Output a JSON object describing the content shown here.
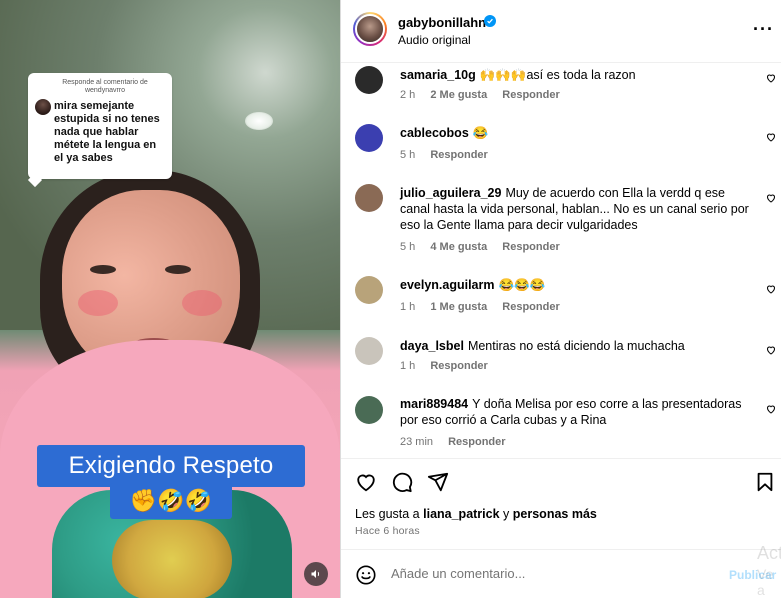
{
  "video": {
    "comment_card": {
      "reply_label": "Responde al comentario de wendynavrro",
      "text": "mira semejante estupida si no tenes nada que hablar métete la lengua en el ya sabes"
    },
    "caption": "Exigiendo Respeto",
    "caption_emojis": "✊🤣🤣",
    "mute_icon": "speaker-icon"
  },
  "post": {
    "username": "gabybonillahn",
    "subtitle": "Audio original",
    "verified": true
  },
  "comments": [
    {
      "user": "samaria_10g",
      "text": "🙌🙌🙌así es toda la razon",
      "time": "2 h",
      "likes": "2 Me gusta",
      "reply": "Responder",
      "avatar_color": "#2a2a2a"
    },
    {
      "user": "cablecobos",
      "text": "😂",
      "time": "5 h",
      "likes": "",
      "reply": "Responder",
      "avatar_color": "#3b3fb0"
    },
    {
      "user": "julio_aguilera_29",
      "text": "Muy de acuerdo con Ella la verdd q ese canal hasta la vida personal, hablan... No es un canal serio por eso la Gente llama para decir vulgaridades",
      "time": "5 h",
      "likes": "4 Me gusta",
      "reply": "Responder",
      "avatar_color": "#8a6a55"
    },
    {
      "user": "evelyn.aguilarm",
      "text": "😂😂😂",
      "time": "1 h",
      "likes": "1 Me gusta",
      "reply": "Responder",
      "avatar_color": "#b8a37a"
    },
    {
      "user": "daya_lsbel",
      "text": "Mentiras no está diciendo la muchacha",
      "time": "1 h",
      "likes": "",
      "reply": "Responder",
      "avatar_color": "#c9c4bb"
    },
    {
      "user": "mari889484",
      "text": "Y doña Melisa por eso corre a las presentadoras por eso corrió a Carla cubas y a Rina",
      "time": "23 min",
      "likes": "",
      "reply": "Responder",
      "avatar_color": "#4a6b55"
    }
  ],
  "actions": {
    "likes_prefix": "Les gusta a",
    "likes_user": "liana_patrick",
    "likes_connector": "y",
    "likes_others": "personas más",
    "posted": "Hace 6 horas"
  },
  "add_comment": {
    "placeholder": "Añade un comentario...",
    "publish": "Publicar"
  },
  "watermark": {
    "line1": "Act",
    "line2": "Ve a"
  },
  "colors": {
    "accent": "#0095f6",
    "caption_bg": "#2d6cd3",
    "muted_text": "#737373"
  }
}
